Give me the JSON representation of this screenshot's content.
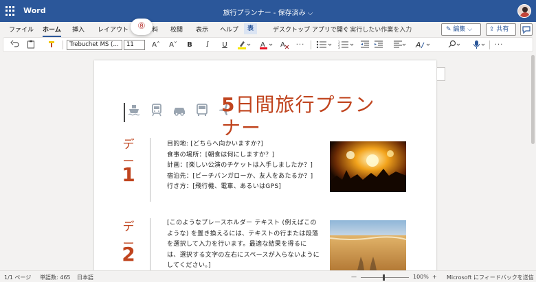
{
  "app": {
    "name": "Word",
    "doc_title": "旅行プランナー - 保存済み ⌵"
  },
  "ribbon": {
    "tabs": [
      {
        "label": "ファイル"
      },
      {
        "label": "ホーム"
      },
      {
        "label": "挿入"
      },
      {
        "label": "レイアウト"
      },
      {
        "label": "参考資料"
      },
      {
        "label": "校閲"
      },
      {
        "label": "表示"
      },
      {
        "label": "ヘルプ"
      },
      {
        "label": "表"
      },
      {
        "label": "デスクトップ アプリで開く"
      }
    ],
    "tell_me": "実行したい作業を入力",
    "edit_label": "✎ 編集 ⌵",
    "share_label": "⇪ 共有"
  },
  "toolbar": {
    "font_name": "Trebuchet MS (…",
    "font_size": "11",
    "grow_font": "A˄",
    "shrink_font": "A˅",
    "bold": "B",
    "italic": "I",
    "underline": "U",
    "more": "···"
  },
  "document": {
    "badge": "⑧",
    "title_num": "5",
    "title_text": "日間旅行プランナー",
    "transport_icons": [
      "ship-icon",
      "train-icon",
      "car-icon",
      "bus-icon",
      "airplane-icon"
    ],
    "accent_color": "#c0441e",
    "days": [
      {
        "label": "デー",
        "num": "1",
        "text": "目的地: [どちらへ向かいますか?]\n食事の場所：[朝食は何にしますか？]\n計画：[楽しい公演のチケットは入手しましたか？]\n宿泊先：[ビーチバンガローか、友人をあたるか？]\n行き方：[飛行機、電車、あるいはGPS]"
      },
      {
        "label": "デー",
        "num": "2",
        "text": "[このようなプレースホルダー テキスト (例えばこのような) を置き換えるには、テキストの行または段落を選択して入力を行います。最適な結果を得るには、選択する文字の左右にスペースが入らないようにしてください。]"
      }
    ]
  },
  "status": {
    "page": "1/1 ページ",
    "words": "単語数: 465",
    "language": "日本語",
    "zoom_out": "—",
    "zoom": "100%",
    "zoom_in": "+",
    "feedback": "Microsoft にフィードバックを送信"
  }
}
